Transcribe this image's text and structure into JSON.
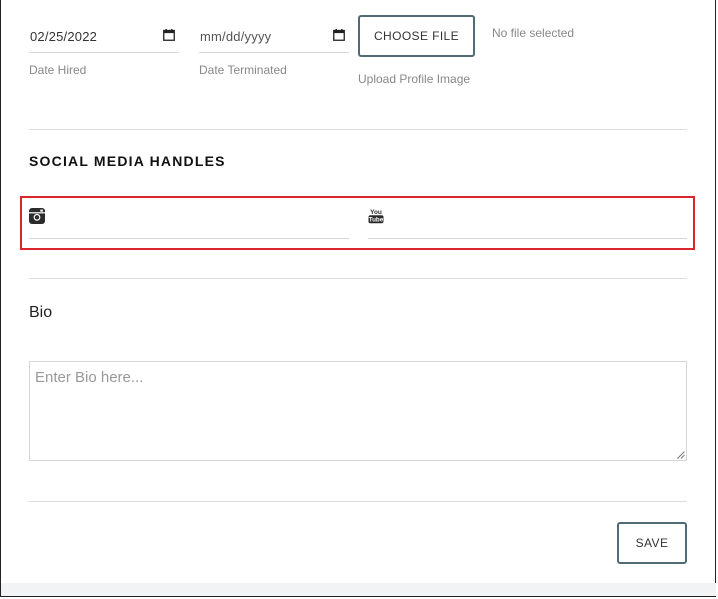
{
  "dates": {
    "hired": {
      "value": "02/25/2022",
      "label": "Date Hired"
    },
    "terminated": {
      "value": "mm/dd/yyyy",
      "label": "Date Terminated"
    }
  },
  "upload": {
    "button_label": "CHOOSE FILE",
    "status": "No file selected",
    "label": "Upload Profile Image"
  },
  "social": {
    "title": "SOCIAL MEDIA HANDLES",
    "instagram_icon": "instagram-icon",
    "youtube_icon": "youtube-icon",
    "youtube_icon_text_top": "You",
    "youtube_icon_text_bottom": "Tube",
    "highlight_color": "#d9262c"
  },
  "bio": {
    "label": "Bio",
    "placeholder": "Enter Bio here..."
  },
  "actions": {
    "save_label": "SAVE"
  },
  "colors": {
    "button_border": "#4f6b75"
  }
}
